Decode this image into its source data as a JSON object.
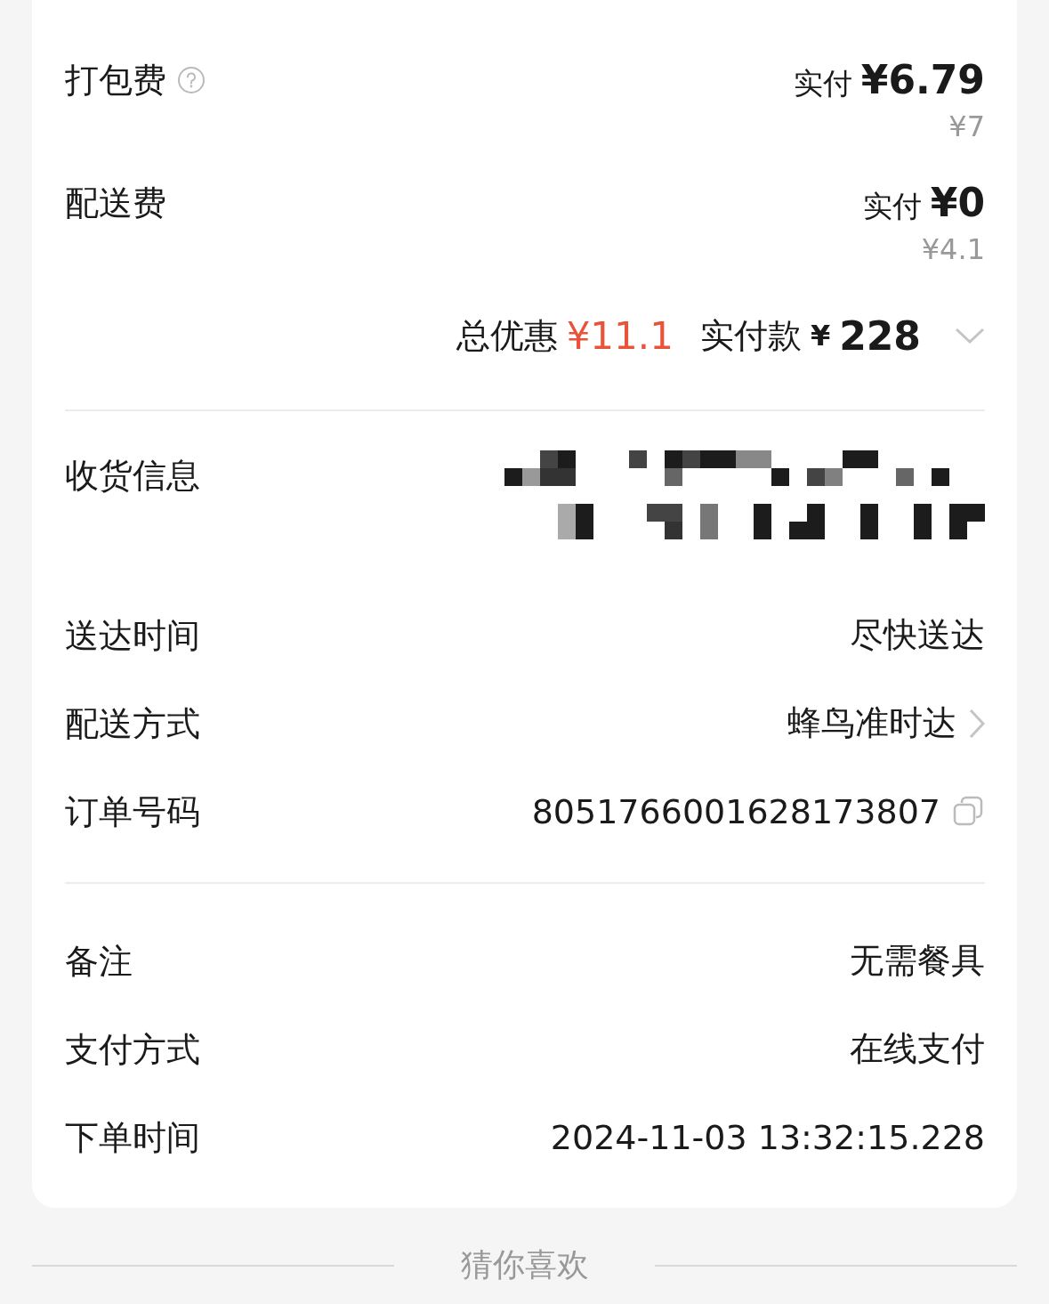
{
  "fees": [
    {
      "label": "打包费",
      "help": true,
      "paid_prefix": "实付",
      "paid_amount": "¥6.79",
      "original": "¥7"
    },
    {
      "label": "配送费",
      "help": false,
      "paid_prefix": "实付",
      "paid_amount": "¥0",
      "original": "¥4.1"
    }
  ],
  "summary": {
    "discount_label": "总优惠",
    "discount_amount": "¥11.1",
    "paid_label": "实付款",
    "paid_currency": "¥",
    "paid_amount": "228",
    "expanded": false
  },
  "info_rows": [
    {
      "kind": "redacted",
      "label": "收货信息"
    },
    {
      "kind": "text",
      "label": "送达时间",
      "value": "尽快送达"
    },
    {
      "kind": "link",
      "label": "配送方式",
      "value": "蜂鸟准时达"
    },
    {
      "kind": "copy",
      "label": "订单号码",
      "value": "8051766001628173807"
    }
  ],
  "extra_rows": [
    {
      "label": "备注",
      "value": "无需餐具"
    },
    {
      "label": "支付方式",
      "value": "在线支付"
    },
    {
      "label": "下单时间",
      "value": "2024-11-03 13:32:15.228"
    }
  ],
  "recommend_title": "猜你喜欢"
}
